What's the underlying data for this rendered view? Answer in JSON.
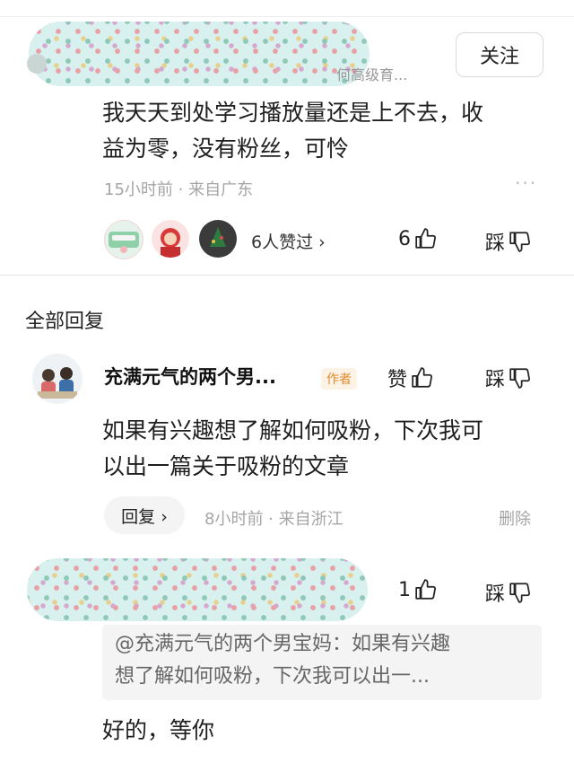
{
  "comment": {
    "user_subtitle": "何高级育...",
    "follow_label": "关注",
    "text_line1": "我天天到处学习播放量还是上不去，收",
    "text_line2": "益为零，没有粉丝，可怜",
    "meta": "15小时前 · 来自广东",
    "more_label": "···",
    "liked_by_label": "6人赞过 ›",
    "like_count": "6",
    "dislike_label": "踩"
  },
  "replies_section": {
    "title": "全部回复"
  },
  "author_reply": {
    "name": "充满元气的两个男...",
    "tag": "作者",
    "like_label": "赞",
    "dislike_label": "踩",
    "text_line1": "如果有兴趣想了解如何吸粉，下次我可",
    "text_line2": "以出一篇关于吸粉的文章",
    "reply_button": "回复 ›",
    "meta": "8小时前 · 来自浙江",
    "delete_label": "删除"
  },
  "user_reply": {
    "like_count": "1",
    "dislike_label": "踩",
    "quote_line1": "@充满元气的两个男宝妈：如果有兴趣",
    "quote_line2": "想了解如何吸粉，下次我可以出一...",
    "text": "好的，等你"
  },
  "colors": {
    "accent_tag": "#e0892c",
    "meta_gray": "#a5a5a5"
  }
}
